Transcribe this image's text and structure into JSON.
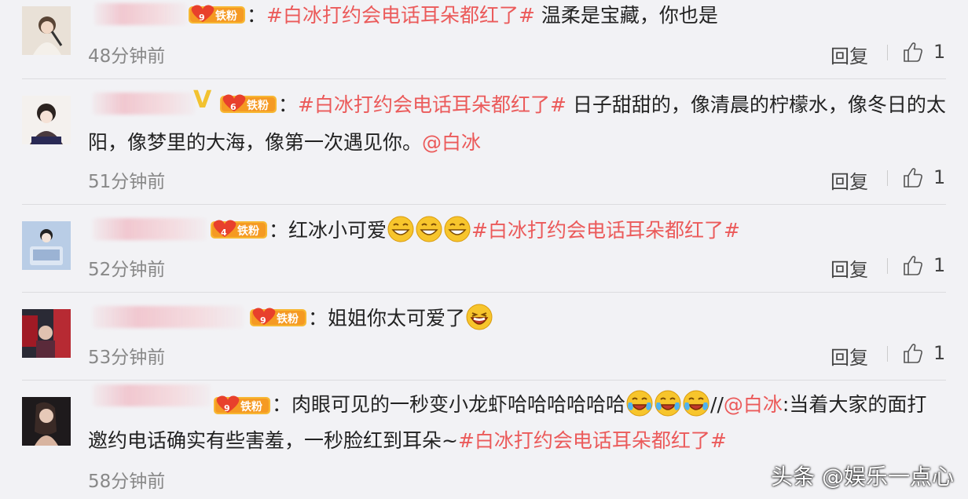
{
  "comments": [
    {
      "text_parts": [
        {
          "t": "：",
          "c": ""
        },
        {
          "t": "#白冰打约会电话耳朵都红了#",
          "c": "tag"
        },
        {
          "t": " 温柔是宝藏，你也是",
          "c": ""
        }
      ],
      "time": "48分钟前",
      "badge_level": "9",
      "badge_label": "铁粉",
      "reply_label": "回复",
      "like_count": "1"
    },
    {
      "text_line1": [
        {
          "t": "：",
          "c": ""
        },
        {
          "t": "#白冰打约会电话耳朵都红了#",
          "c": "tag"
        },
        {
          "t": " 日子甜甜的，像清晨的柠檬水，像冬日的太",
          "c": ""
        }
      ],
      "text_line2": [
        {
          "t": "阳，像梦里的大海，像第一次遇见你。",
          "c": ""
        },
        {
          "t": "@白冰",
          "c": "at"
        }
      ],
      "time": "51分钟前",
      "badge_level": "6",
      "badge_label": "铁粉",
      "verified_mark": "V",
      "reply_label": "回复",
      "like_count": "1"
    },
    {
      "text_before": "：红冰小可爱",
      "text_after": "#白冰打约会电话耳朵都红了#",
      "time": "52分钟前",
      "badge_level": "4",
      "badge_label": "铁粉",
      "reply_label": "回复",
      "like_count": "1"
    },
    {
      "text_before": "：姐姐你太可爱了",
      "time": "53分钟前",
      "badge_level": "9",
      "badge_label": "铁粉",
      "reply_label": "回复",
      "like_count": "1"
    },
    {
      "text_line1_a": "：肉眼可见的一秒变小龙虾哈哈哈哈哈哈",
      "text_line1_b": "//",
      "text_line1_at": "@白冰",
      "text_line1_c": ":当着大家的面打",
      "text_line2_a": "邀约电话确实有些害羞，一秒脸红到耳朵~",
      "text_line2_tag": "#白冰打约会电话耳朵都红了#",
      "time": "58分钟前",
      "badge_level": "9",
      "badge_label": "铁粉"
    }
  ],
  "watermark": "头条 @娱乐一点心",
  "colors": {
    "tag": "#eb5a5a",
    "badge": "#f5a623",
    "bg": "#f2f2f5"
  },
  "icons": [
    "thumbs-up-icon",
    "fan-badge-icon",
    "grin-emoji-icon",
    "laugh-emoji-icon",
    "laugh-tears-emoji-icon"
  ]
}
